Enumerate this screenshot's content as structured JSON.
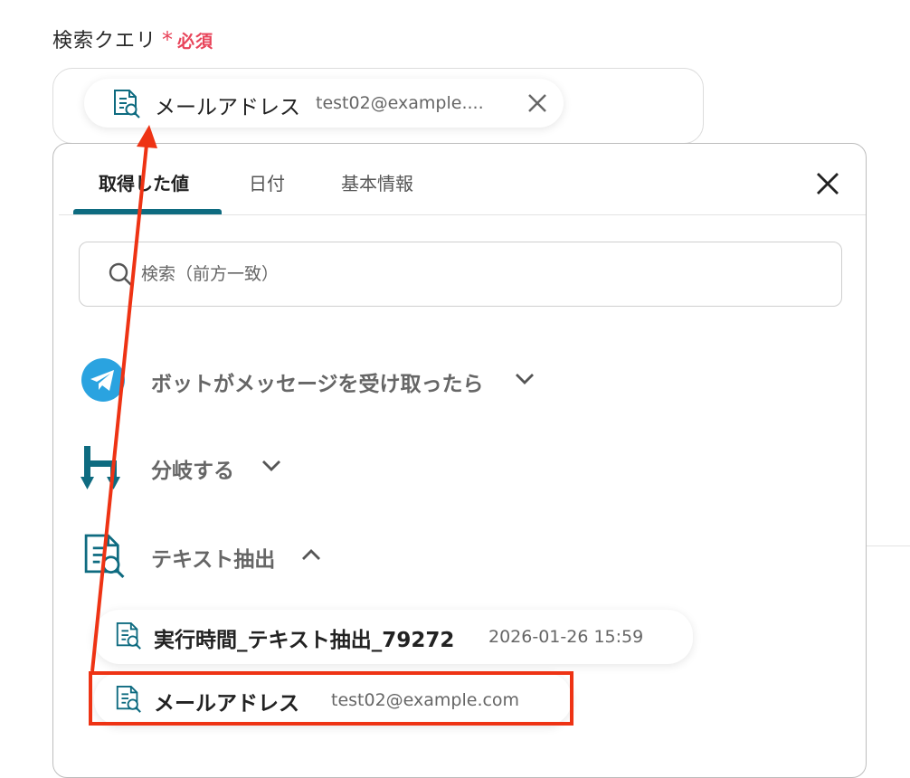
{
  "field": {
    "label": "検索クエリ",
    "required_mark": "*",
    "required_text": "必須"
  },
  "query_chip": {
    "icon": "text-extract-icon",
    "name": "メールアドレス",
    "value": "test02@example....",
    "remove_icon": "close-icon"
  },
  "panel": {
    "tabs": [
      {
        "label": "取得した値",
        "active": true
      },
      {
        "label": "日付",
        "active": false
      },
      {
        "label": "基本情報",
        "active": false
      }
    ],
    "close_icon": "close-icon",
    "search": {
      "icon": "search-icon",
      "placeholder": "検索（前方一致）",
      "value": ""
    },
    "sections": [
      {
        "title": "ボットがメッセージを受け取ったら",
        "icon": "telegram-icon",
        "expanded": false
      },
      {
        "title": "分岐する",
        "icon": "branch-icon",
        "expanded": false
      },
      {
        "title": "テキスト抽出",
        "icon": "text-extract-icon",
        "expanded": true
      }
    ],
    "items": [
      {
        "name": "実行時間_テキスト抽出_79272",
        "value": "2026-01-26 15:59",
        "icon": "text-extract-icon"
      },
      {
        "name": "メールアドレス",
        "value": "test02@example.com",
        "icon": "text-extract-icon"
      }
    ]
  },
  "colors": {
    "accent": "#0e6b80",
    "required": "#e8445a",
    "annotation": "#ee3314",
    "telegram": "#2aa3e0"
  }
}
